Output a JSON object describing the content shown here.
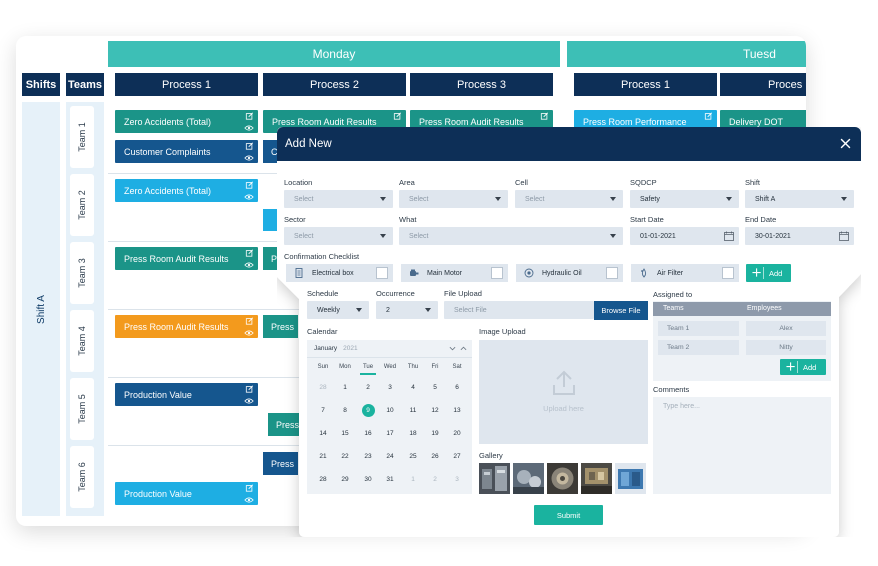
{
  "colors": {
    "navy": "#0d2f57",
    "teal_header": "#3dbfb6",
    "task_teal": "#1b9488",
    "task_navy": "#15568e",
    "task_sky": "#1eaee3",
    "task_orange": "#f39a1d",
    "accent_green": "#1ab39f"
  },
  "board": {
    "days": [
      "Monday",
      "Tuesd"
    ],
    "shifts_header": "Shifts",
    "teams_header": "Teams",
    "shift_name": "Shift A",
    "teams": [
      "Team 1",
      "Team 2",
      "Team 3",
      "Team 4",
      "Team 5",
      "Team 6"
    ],
    "process_headers": [
      "Process 1",
      "Process 2",
      "Process 3",
      "Process 1",
      "Proces"
    ],
    "tasks": [
      "Zero Accidents (Total)",
      "Customer Complaints",
      "Zero Accidents (Total)",
      "Press Room Audit Results",
      "Press Room Audit Results",
      "Production Value",
      "Press Room Audit Results",
      "Press Room Audit Results",
      "Production Value",
      "Press Room Performance",
      "Delivery DOT"
    ],
    "fragments": [
      "C",
      "P",
      "Press",
      "Press",
      "Press"
    ]
  },
  "modal": {
    "title": "Add New",
    "labels": {
      "location": "Location",
      "area": "Area",
      "cell": "Cell",
      "sqdcp": "SQDCP",
      "shift": "Shift",
      "sector": "Sector",
      "what": "What",
      "start_date": "Start Date",
      "end_date": "End Date",
      "checklist": "Confirmation Checklist",
      "schedule": "Schedule",
      "occurrence": "Occurrence",
      "file_upload": "File Upload",
      "assigned_to": "Assigned to",
      "calendar": "Calendar",
      "image_upload": "Image Upload",
      "gallery": "Gallery",
      "comments": "Comments"
    },
    "placeholders": {
      "select": "Select",
      "select_file": "Select File",
      "upload_here": "Upload here",
      "type_here": "Type here..."
    },
    "values": {
      "sqdcp": "Safety",
      "shift": "Shift A",
      "start_date": "01-01-2021",
      "end_date": "30-01-2021",
      "schedule": "Weekly",
      "occurrence": "2"
    },
    "checklist": [
      "Electrical box",
      "Main Motor",
      "Hydraulic Oil",
      "Air Filter"
    ],
    "buttons": {
      "add": "Add",
      "browse": "Browse File",
      "submit": "Submit"
    },
    "calendar": {
      "month": "January",
      "year": "2021",
      "weekdays": [
        "Sun",
        "Mon",
        "Tue",
        "Wed",
        "Thu",
        "Fri",
        "Sat"
      ],
      "weeks": [
        [
          "28",
          "1",
          "2",
          "3",
          "4",
          "5",
          "6"
        ],
        [
          "7",
          "8",
          "9",
          "10",
          "11",
          "12",
          "13"
        ],
        [
          "14",
          "15",
          "16",
          "17",
          "18",
          "19",
          "20"
        ],
        [
          "21",
          "22",
          "23",
          "24",
          "25",
          "26",
          "27"
        ],
        [
          "28",
          "29",
          "30",
          "31",
          "1",
          "2",
          "3"
        ]
      ],
      "selected": "9"
    },
    "assigned": {
      "headers": [
        "Teams",
        "Employees"
      ],
      "rows": [
        [
          "Team 1",
          "Alex"
        ],
        [
          "Team 2",
          "Nitty"
        ]
      ]
    }
  }
}
